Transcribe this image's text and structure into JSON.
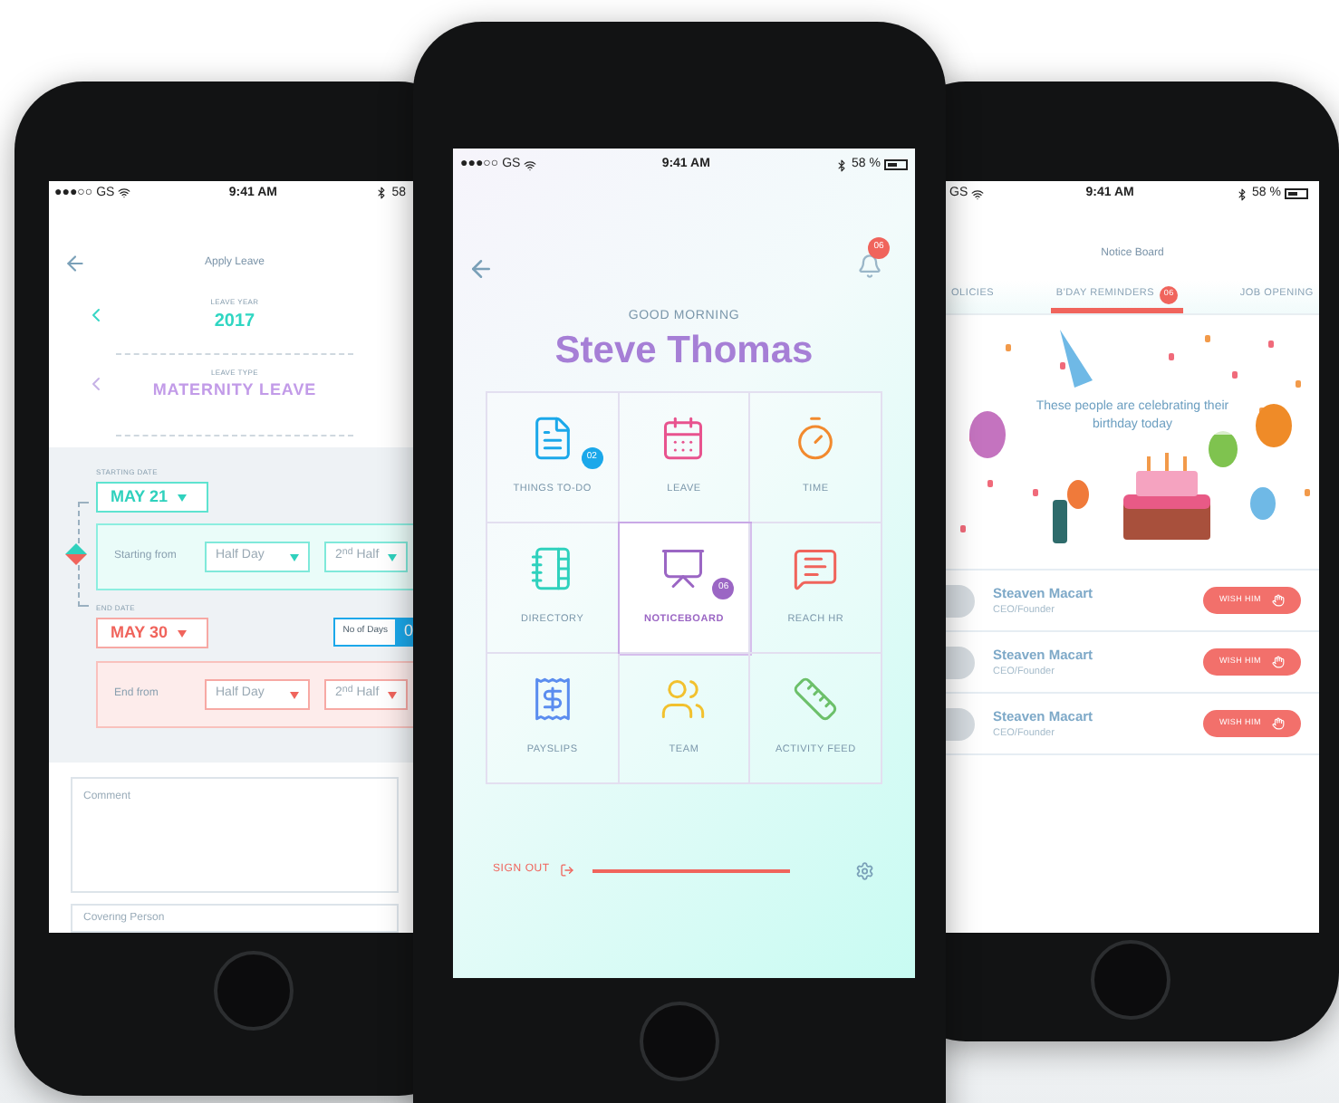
{
  "left_phone": {
    "status_bar": {
      "carrier": "●●●○○ GS",
      "time": "9:41 AM",
      "battery": "58"
    },
    "title": "Apply Leave",
    "leave_year": {
      "label": "LEAVE YEAR",
      "value": "2017"
    },
    "leave_type": {
      "label": "LEAVE TYPE",
      "value": "MATERNITY LEAVE"
    },
    "start": {
      "label": "STARTING DATE",
      "date": "MAY 21",
      "from_label": "Starting from",
      "day": "Half Day",
      "half": "2$^{nd}$ Half"
    },
    "end": {
      "label": "END DATE",
      "date": "MAY 30",
      "days_label": "No of Days",
      "days": "0",
      "from_label": "End from",
      "day": "Half Day",
      "half": "2$^{nd}$ Half"
    },
    "comment": {
      "placeholder": "Comment"
    },
    "covering_person": {
      "placeholder": "Covering Person"
    }
  },
  "center_phone": {
    "status_bar": {
      "carrier": "●●●○○ GS",
      "time": "9:41 AM",
      "battery": "58 %"
    },
    "notifications": "06",
    "greeting": "GOOD MORNING",
    "name": "Steve Thomas",
    "tiles": [
      {
        "label": "THINGS TO-DO",
        "selected": false,
        "badge": {
          "text": "02",
          "color": "#1ba8ea"
        }
      },
      {
        "label": "LEAVE",
        "selected": false
      },
      {
        "label": "TIME",
        "selected": false
      },
      {
        "label": "DIRECTORY",
        "selected": false
      },
      {
        "label": "NOTICEBOARD",
        "selected": true,
        "badge": {
          "text": "06",
          "color": "#9b66c4"
        }
      },
      {
        "label": "REACH HR",
        "selected": false
      },
      {
        "label": "PAYSLIPS",
        "selected": false
      },
      {
        "label": "TEAM",
        "selected": false
      },
      {
        "label": "ACTIVITY FEED",
        "selected": false
      }
    ],
    "sign_out": "SIGN OUT"
  },
  "right_phone": {
    "status_bar": {
      "carrier": "GS",
      "time": "9:41 AM",
      "battery": "58 %"
    },
    "title": "Notice Board",
    "tabs": [
      {
        "label": "OLICIES",
        "selected": false
      },
      {
        "label": "B'DAY REMINDERS",
        "selected": true,
        "badge": "06"
      },
      {
        "label": "JOB OPENING",
        "selected": false
      }
    ],
    "message": "These people are celebrating their birthday today",
    "people": [
      {
        "name": "Steaven Macart",
        "role": "CEO/Founder",
        "action": "WISH HIM"
      },
      {
        "name": "Steaven Macart",
        "role": "CEO/Founder",
        "action": "WISH HIM"
      },
      {
        "name": "Steaven Macart",
        "role": "CEO/Founder",
        "action": "WISH HIM"
      }
    ]
  }
}
